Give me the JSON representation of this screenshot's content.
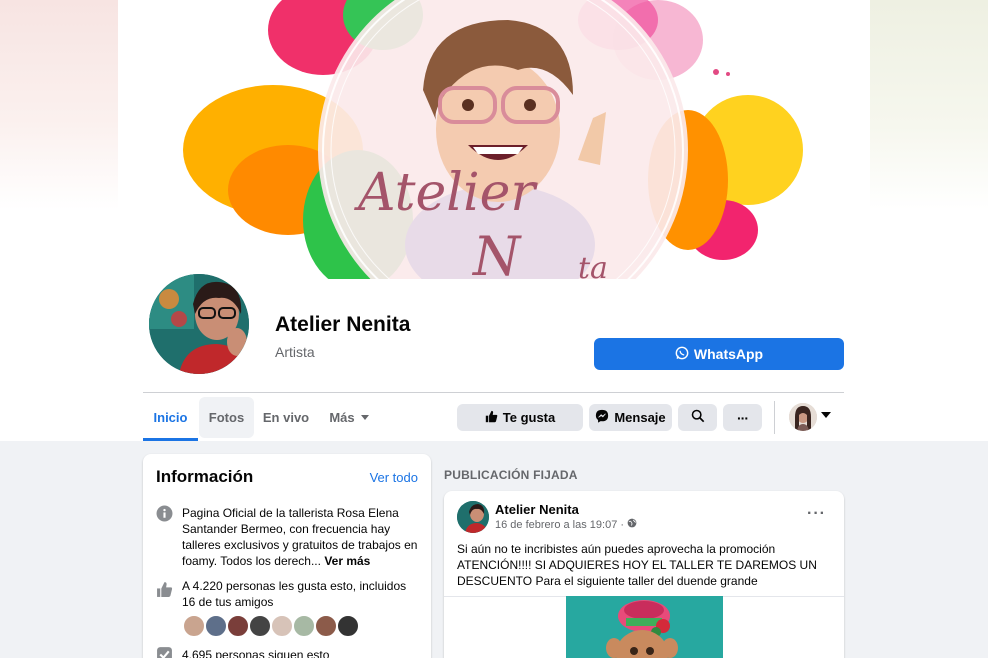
{
  "page": {
    "name": "Atelier Nenita",
    "category": "Artista",
    "cover_text": "Atelier Nenita"
  },
  "buttons": {
    "whatsapp": "WhatsApp",
    "like": "Te gusta",
    "message": "Mensaje",
    "more_dots": "···"
  },
  "tabs": [
    "Inicio",
    "Fotos",
    "En vivo",
    "Más"
  ],
  "info": {
    "title": "Información",
    "see_all": "Ver todo",
    "description": "Pagina Oficial de la tallerista Rosa Elena Santander Bermeo, con frecuencia hay talleres exclusivos y gratuitos de trabajos en foamy. Todos los derech...",
    "see_more": "Ver más",
    "likes": "A 4.220 personas les gusta esto, incluidos 16 de tus amigos",
    "followers": "4.695 personas siguen esto"
  },
  "pinned": {
    "label": "PUBLICACIÓN FIJADA",
    "author": "Atelier Nenita",
    "time": "16 de febrero a las 19:07 ·",
    "text": "Si aún no te incribistes aún puedes aprovecha la promoción ATENCIÓN!!!! SI ADQUIERES HOY EL TALLER TE DAREMOS UN DESCUENTO Para el siguiente taller del duende grande",
    "more": "···"
  },
  "colors": {
    "accent": "#1b74e4",
    "background": "#f0f2f5",
    "button_gray": "#e4e6eb",
    "secondary_text": "#65676b"
  },
  "icons": [
    "whatsapp-icon",
    "thumbs-up-icon",
    "messenger-icon",
    "search-icon",
    "info-icon",
    "like-icon",
    "check-icon",
    "globe-icon",
    "caret-down-icon"
  ]
}
